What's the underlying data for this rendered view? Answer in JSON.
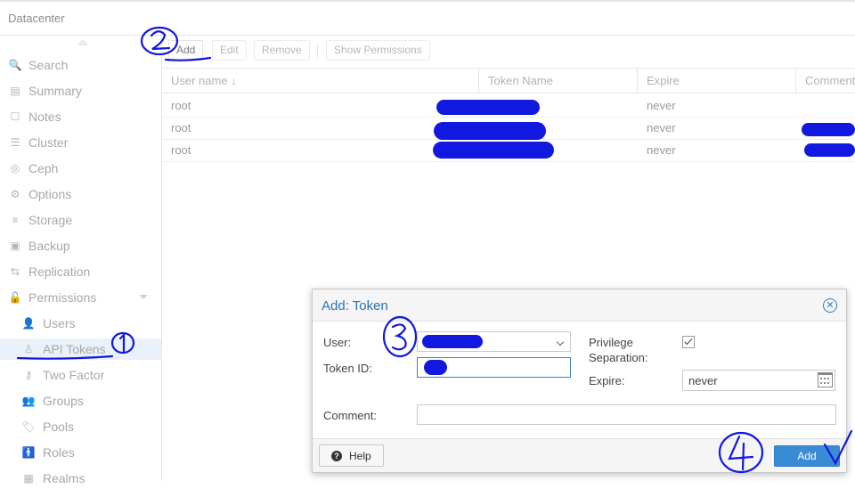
{
  "topbar": {
    "title": "Datacenter"
  },
  "sidebar": {
    "items": [
      {
        "label": "Search",
        "icon": "search-icon",
        "glyph": "🔍"
      },
      {
        "label": "Summary",
        "icon": "book-icon",
        "glyph": "▤"
      },
      {
        "label": "Notes",
        "icon": "notes-icon",
        "glyph": "☐"
      },
      {
        "label": "Cluster",
        "icon": "server-icon",
        "glyph": "☰"
      },
      {
        "label": "Ceph",
        "icon": "ceph-icon",
        "glyph": "◎"
      },
      {
        "label": "Options",
        "icon": "gear-icon",
        "glyph": "⚙"
      },
      {
        "label": "Storage",
        "icon": "database-icon",
        "glyph": "≡"
      },
      {
        "label": "Backup",
        "icon": "floppy-icon",
        "glyph": "▣"
      },
      {
        "label": "Replication",
        "icon": "retweet-icon",
        "glyph": "⇆"
      },
      {
        "label": "Permissions",
        "icon": "unlock-icon",
        "glyph": "🔓"
      },
      {
        "label": "Users",
        "icon": "user-icon",
        "glyph": "👤"
      },
      {
        "label": "API Tokens",
        "icon": "user-outline-icon",
        "glyph": "♙"
      },
      {
        "label": "Two Factor",
        "icon": "key-icon",
        "glyph": "⚷"
      },
      {
        "label": "Groups",
        "icon": "users-icon",
        "glyph": "👥"
      },
      {
        "label": "Pools",
        "icon": "tags-icon",
        "glyph": "🏷"
      },
      {
        "label": "Roles",
        "icon": "male-icon",
        "glyph": "🚹"
      },
      {
        "label": "Realms",
        "icon": "address-book-icon",
        "glyph": "▦"
      }
    ]
  },
  "toolbar": {
    "add_label": "Add",
    "edit_label": "Edit",
    "remove_label": "Remove",
    "show_permissions_label": "Show Permissions"
  },
  "grid": {
    "columns": [
      "User name ↓",
      "Token Name",
      "Expire",
      "Comment"
    ],
    "rows": [
      {
        "user": "root",
        "expire": "never"
      },
      {
        "user": "root",
        "expire": "never"
      },
      {
        "user": "root",
        "expire": "never"
      }
    ]
  },
  "dialog": {
    "title": "Add: Token",
    "close_glyph": "✕",
    "user_label": "User:",
    "token_id_label": "Token ID:",
    "comment_label": "Comment:",
    "privilege_label_1": "Privilege",
    "privilege_label_2": "Separation:",
    "privilege_checked": true,
    "expire_label": "Expire:",
    "expire_value": "never",
    "help_label": "Help",
    "help_glyph": "?",
    "add_label": "Add"
  },
  "colors": {
    "accent": "#3a8bd6",
    "title_blue": "#2a74b8",
    "annotation": "#1118e0"
  }
}
